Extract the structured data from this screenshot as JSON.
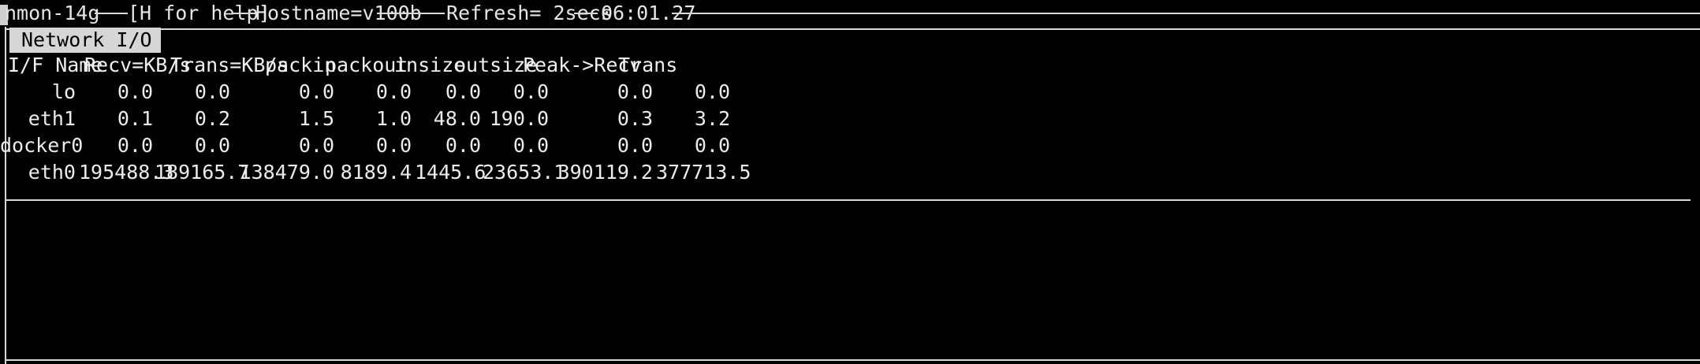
{
  "topbar": {
    "app": "nmon-14g",
    "help": "[H for help]",
    "hostname": "Hostname=v100b",
    "refresh": "Refresh= 2secs",
    "time": "06:01.27"
  },
  "section": {
    "title": "Network I/O"
  },
  "table": {
    "headers": [
      "I/F Name",
      "Recv=KB/s",
      "Trans=KB/s",
      "packin",
      "packout",
      "insize",
      "outsize",
      "Peak->Recv",
      "Trans"
    ],
    "rows": [
      [
        "lo",
        "0.0",
        "0.0",
        "0.0",
        "0.0",
        "0.0",
        "0.0",
        "0.0",
        "0.0"
      ],
      [
        "eth1",
        "0.1",
        "0.2",
        "1.5",
        "1.0",
        "48.0",
        "190.0",
        "0.3",
        "3.2"
      ],
      [
        "docker0",
        "0.0",
        "0.0",
        "0.0",
        "0.0",
        "0.0",
        "0.0",
        "0.0",
        "0.0"
      ],
      [
        "eth0",
        "195488.3",
        "189165.7",
        "138479.0",
        "8189.4",
        "1445.6",
        "23653.1",
        "390119.2",
        "377713.5"
      ]
    ]
  },
  "colors": {
    "background": "#000000",
    "foreground": "#e8e8e8",
    "title_bg": "#d6d6d6",
    "title_fg": "#000000"
  }
}
